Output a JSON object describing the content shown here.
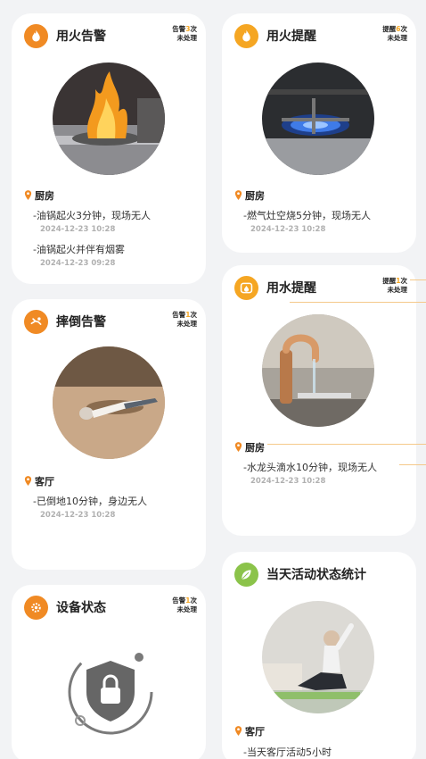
{
  "cards": {
    "fire_alarm": {
      "title": "用火告警",
      "badge_prefix": "告警",
      "badge_num": "3",
      "badge_suffix": "次",
      "badge_status": "未处理",
      "location": "厨房",
      "events": [
        {
          "text": "-油锅起火3分钟，现场无人",
          "time": "2024-12-23 10:28"
        },
        {
          "text": "-油锅起火并伴有烟雾",
          "time": "2024-12-23 09:28"
        }
      ]
    },
    "fire_remind": {
      "title": "用火提醒",
      "badge_prefix": "提醒",
      "badge_num": "6",
      "badge_suffix": "次",
      "badge_status": "未处理",
      "location": "厨房",
      "events": [
        {
          "text": "-燃气灶空烧5分钟，现场无人",
          "time": "2024-12-23 10:28"
        }
      ]
    },
    "fall_alarm": {
      "title": "摔倒告警",
      "badge_prefix": "告警",
      "badge_num": "1",
      "badge_suffix": "次",
      "badge_status": "未处理",
      "location": "客厅",
      "events": [
        {
          "text": "-已倒地10分钟，身边无人",
          "time": "2024-12-23 10:28"
        }
      ]
    },
    "water_remind": {
      "title": "用水提醒",
      "badge_prefix": "提醒",
      "badge_num": "1",
      "badge_suffix": "次",
      "badge_status": "未处理",
      "location": "厨房",
      "events": [
        {
          "text": "-水龙头滴水10分钟，现场无人",
          "time": "2024-12-23 10:28"
        }
      ]
    },
    "device_status": {
      "title": "设备状态",
      "badge_prefix": "告警",
      "badge_num": "1",
      "badge_suffix": "次",
      "badge_status": "未处理"
    },
    "activity_stats": {
      "title": "当天活动状态统计",
      "location": "客厅",
      "events": [
        {
          "text": "-当天客厅活动5小时"
        }
      ]
    }
  },
  "colors": {
    "accent": "#f08a24",
    "badge_number": "#f5a623",
    "activity_icon": "#8bc34a",
    "time_text": "#b0b0b0"
  },
  "icons": {
    "fire_alarm": "flame-icon",
    "fire_remind": "flame-icon",
    "fall_alarm": "fall-person-icon",
    "water_remind": "faucet-icon",
    "device_status": "gear-icon",
    "activity_stats": "leaf-icon",
    "location": "location-pin-icon",
    "device": "lock-shield-icon"
  }
}
